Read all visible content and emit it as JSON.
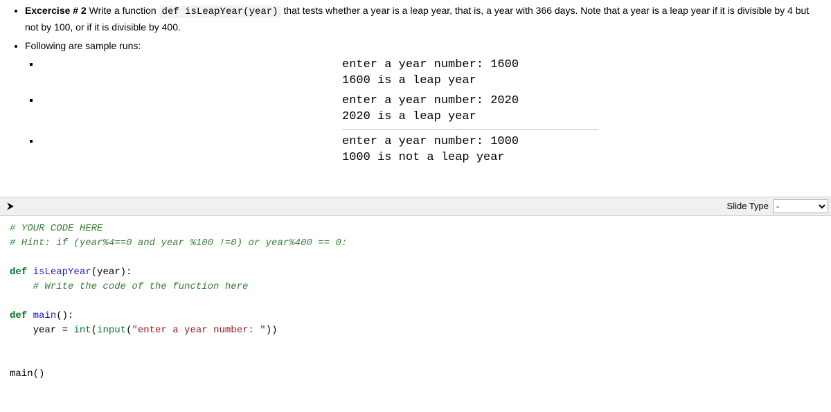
{
  "exercise": {
    "heading_prefix": "Excercise # 2",
    "text_before_code": " Write a function ",
    "inline_code": "def isLeapYear(year)",
    "text_after_code": " that tests whether a year is a leap year, that is, a year with 366 days. Note that a year is a leap year if it is divisible by 4 but not by 100, or if it is divisible by 400.",
    "following_label": "Following are sample runs:"
  },
  "samples": [
    "enter a year number: 1600\n1600 is a leap year",
    "enter a year number: 2020\n2020 is a leap year",
    "enter a year number: 1000\n1000 is not a leap year"
  ],
  "toolbar": {
    "run_symbol": "⮞",
    "slide_type_label": "Slide Type",
    "slide_type_value": "-"
  },
  "code": {
    "c1": "# YOUR CODE HERE",
    "c2": "# Hint: if (year%4==0 and year %100 !=0) or year%400 == 0:",
    "kw_def1": "def",
    "fn1": " isLeapYear",
    "sig1": "(year):",
    "c3": "    # Write the code of the function here",
    "kw_def2": "def",
    "fn2": " main",
    "sig2": "():",
    "body_indent": "    year = ",
    "builtin_int": "int",
    "paren_input": "(",
    "builtin_input": "input",
    "str_open": "(",
    "str_literal": "\"enter a year number: \"",
    "str_close": "))",
    "call_main": "main()"
  }
}
